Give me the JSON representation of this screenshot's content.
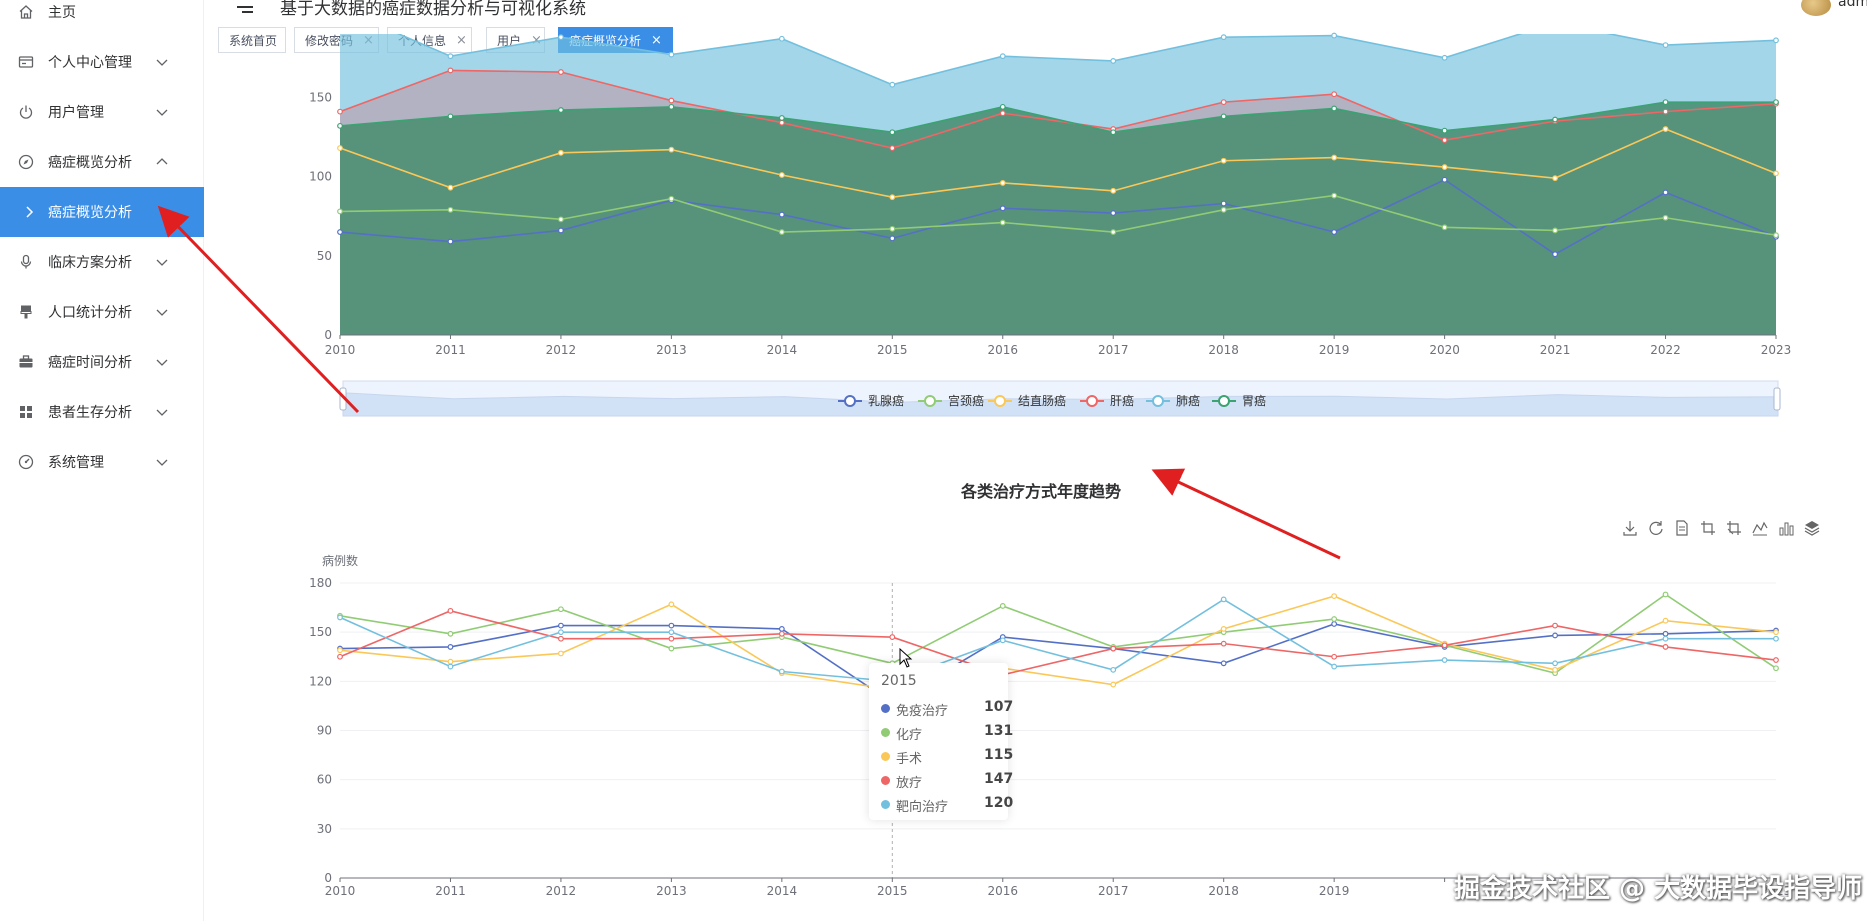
{
  "app": {
    "title": "基于大数据的癌症数据分析与可视化系统",
    "user": "adm"
  },
  "sidebar": {
    "items": [
      {
        "label": "主页",
        "icon": "home-icon",
        "expandable": false,
        "state": "none"
      },
      {
        "label": "个人中心管理",
        "icon": "id-card-icon",
        "expandable": true,
        "state": "collapsed"
      },
      {
        "label": "用户管理",
        "icon": "power-icon",
        "expandable": true,
        "state": "collapsed"
      },
      {
        "label": "癌症概览分析",
        "icon": "compass-icon",
        "expandable": true,
        "state": "expanded"
      },
      {
        "label": "癌症概览分析",
        "icon": "chevron-right-icon",
        "expandable": false,
        "state": "active"
      },
      {
        "label": "临床方案分析",
        "icon": "microphone-icon",
        "expandable": true,
        "state": "collapsed"
      },
      {
        "label": "人口统计分析",
        "icon": "brush-icon",
        "expandable": true,
        "state": "collapsed"
      },
      {
        "label": "癌症时间分析",
        "icon": "briefcase-icon",
        "expandable": true,
        "state": "collapsed"
      },
      {
        "label": "患者生存分析",
        "icon": "grid-icon",
        "expandable": true,
        "state": "collapsed"
      },
      {
        "label": "系统管理",
        "icon": "speedometer-icon",
        "expandable": true,
        "state": "collapsed"
      }
    ]
  },
  "tabs": [
    {
      "label": "系统首页",
      "closable": false,
      "active": false
    },
    {
      "label": "修改密码",
      "closable": true,
      "active": false
    },
    {
      "label": "个人信息",
      "closable": true,
      "active": false
    },
    {
      "label": "用户",
      "closable": true,
      "active": false
    },
    {
      "label": "癌症概览分析",
      "closable": true,
      "active": true
    }
  ],
  "colors": {
    "accent": "#3a8ee6",
    "annotation_arrow": "#e02020"
  },
  "chart_data": [
    {
      "type": "area",
      "title": "",
      "x": [
        "2010",
        "2011",
        "2012",
        "2013",
        "2014",
        "2015",
        "2016",
        "2017",
        "2018",
        "2019",
        "2020",
        "2021",
        "2022",
        "2023"
      ],
      "yticks": [
        0,
        50,
        100,
        150
      ],
      "ylim": [
        0,
        190
      ],
      "grid": false,
      "legend_position": "bottom-center",
      "series": [
        {
          "name": "乳腺癌",
          "color": "#5470c6",
          "values": [
            65,
            59,
            66,
            85,
            76,
            61,
            80,
            77,
            83,
            65,
            98,
            51,
            90,
            62
          ]
        },
        {
          "name": "宫颈癌",
          "color": "#91cc75",
          "values": [
            78,
            79,
            73,
            86,
            65,
            67,
            71,
            65,
            79,
            88,
            68,
            66,
            74,
            63
          ]
        },
        {
          "name": "结直肠癌",
          "color": "#fac858",
          "values": [
            118,
            93,
            115,
            117,
            101,
            87,
            96,
            91,
            110,
            112,
            106,
            99,
            130,
            102
          ]
        },
        {
          "name": "肝癌",
          "color": "#ee6666",
          "values": [
            141,
            167,
            166,
            148,
            134,
            118,
            140,
            130,
            147,
            152,
            123,
            135,
            141,
            146
          ]
        },
        {
          "name": "肺癌",
          "color": "#73c0de",
          "values": [
            206,
            176,
            188,
            177,
            187,
            158,
            176,
            173,
            188,
            189,
            175,
            197,
            183,
            186
          ]
        },
        {
          "name": "胃癌",
          "color": "#3ba272",
          "values": [
            132,
            138,
            142,
            144,
            137,
            128,
            144,
            128,
            138,
            143,
            129,
            136,
            147,
            147
          ]
        }
      ]
    },
    {
      "type": "line",
      "title": "各类治疗方式年度趋势",
      "ylabel": "病例数",
      "x": [
        "2010",
        "2011",
        "2012",
        "2013",
        "2014",
        "2015",
        "2016",
        "2017",
        "2018",
        "2019",
        "2020",
        "2021",
        "2022",
        "2023"
      ],
      "yticks": [
        0,
        30,
        60,
        90,
        120,
        150,
        180
      ],
      "ylim": [
        0,
        180
      ],
      "grid": true,
      "series": [
        {
          "name": "免疫治疗",
          "color": "#5470c6",
          "values": [
            140,
            141,
            154,
            154,
            152,
            107,
            147,
            140,
            131,
            155,
            141,
            148,
            149,
            151
          ]
        },
        {
          "name": "化疗",
          "color": "#91cc75",
          "values": [
            160,
            149,
            164,
            140,
            147,
            131,
            166,
            141,
            150,
            158,
            142,
            125,
            173,
            128
          ]
        },
        {
          "name": "手术",
          "color": "#fac858",
          "values": [
            139,
            132,
            137,
            167,
            125,
            115,
            128,
            118,
            152,
            172,
            143,
            127,
            157,
            150
          ]
        },
        {
          "name": "放疗",
          "color": "#ee6666",
          "values": [
            135,
            163,
            146,
            146,
            149,
            147,
            124,
            140,
            143,
            135,
            142,
            154,
            141,
            133
          ]
        },
        {
          "name": "靶向治疗",
          "color": "#73c0de",
          "values": [
            159,
            129,
            150,
            150,
            126,
            120,
            145,
            127,
            170,
            129,
            133,
            131,
            146,
            146
          ]
        }
      ],
      "tooltip": {
        "category": "2015",
        "rows": [
          {
            "name": "免疫治疗",
            "value": "107",
            "color": "#5470c6"
          },
          {
            "name": "化疗",
            "value": "131",
            "color": "#91cc75"
          },
          {
            "name": "手术",
            "value": "115",
            "color": "#fac858"
          },
          {
            "name": "放疗",
            "value": "147",
            "color": "#ee6666"
          },
          {
            "name": "靶向治疗",
            "value": "120",
            "color": "#73c0de"
          }
        ]
      },
      "toolbox": [
        "download-icon",
        "refresh-icon",
        "data-view-icon",
        "zoom-icon",
        "zoom-reset-icon",
        "line-chart-icon",
        "bar-chart-icon",
        "stack-icon"
      ]
    }
  ],
  "watermark": "掘金技术社区 @ 大数据毕设指导师"
}
